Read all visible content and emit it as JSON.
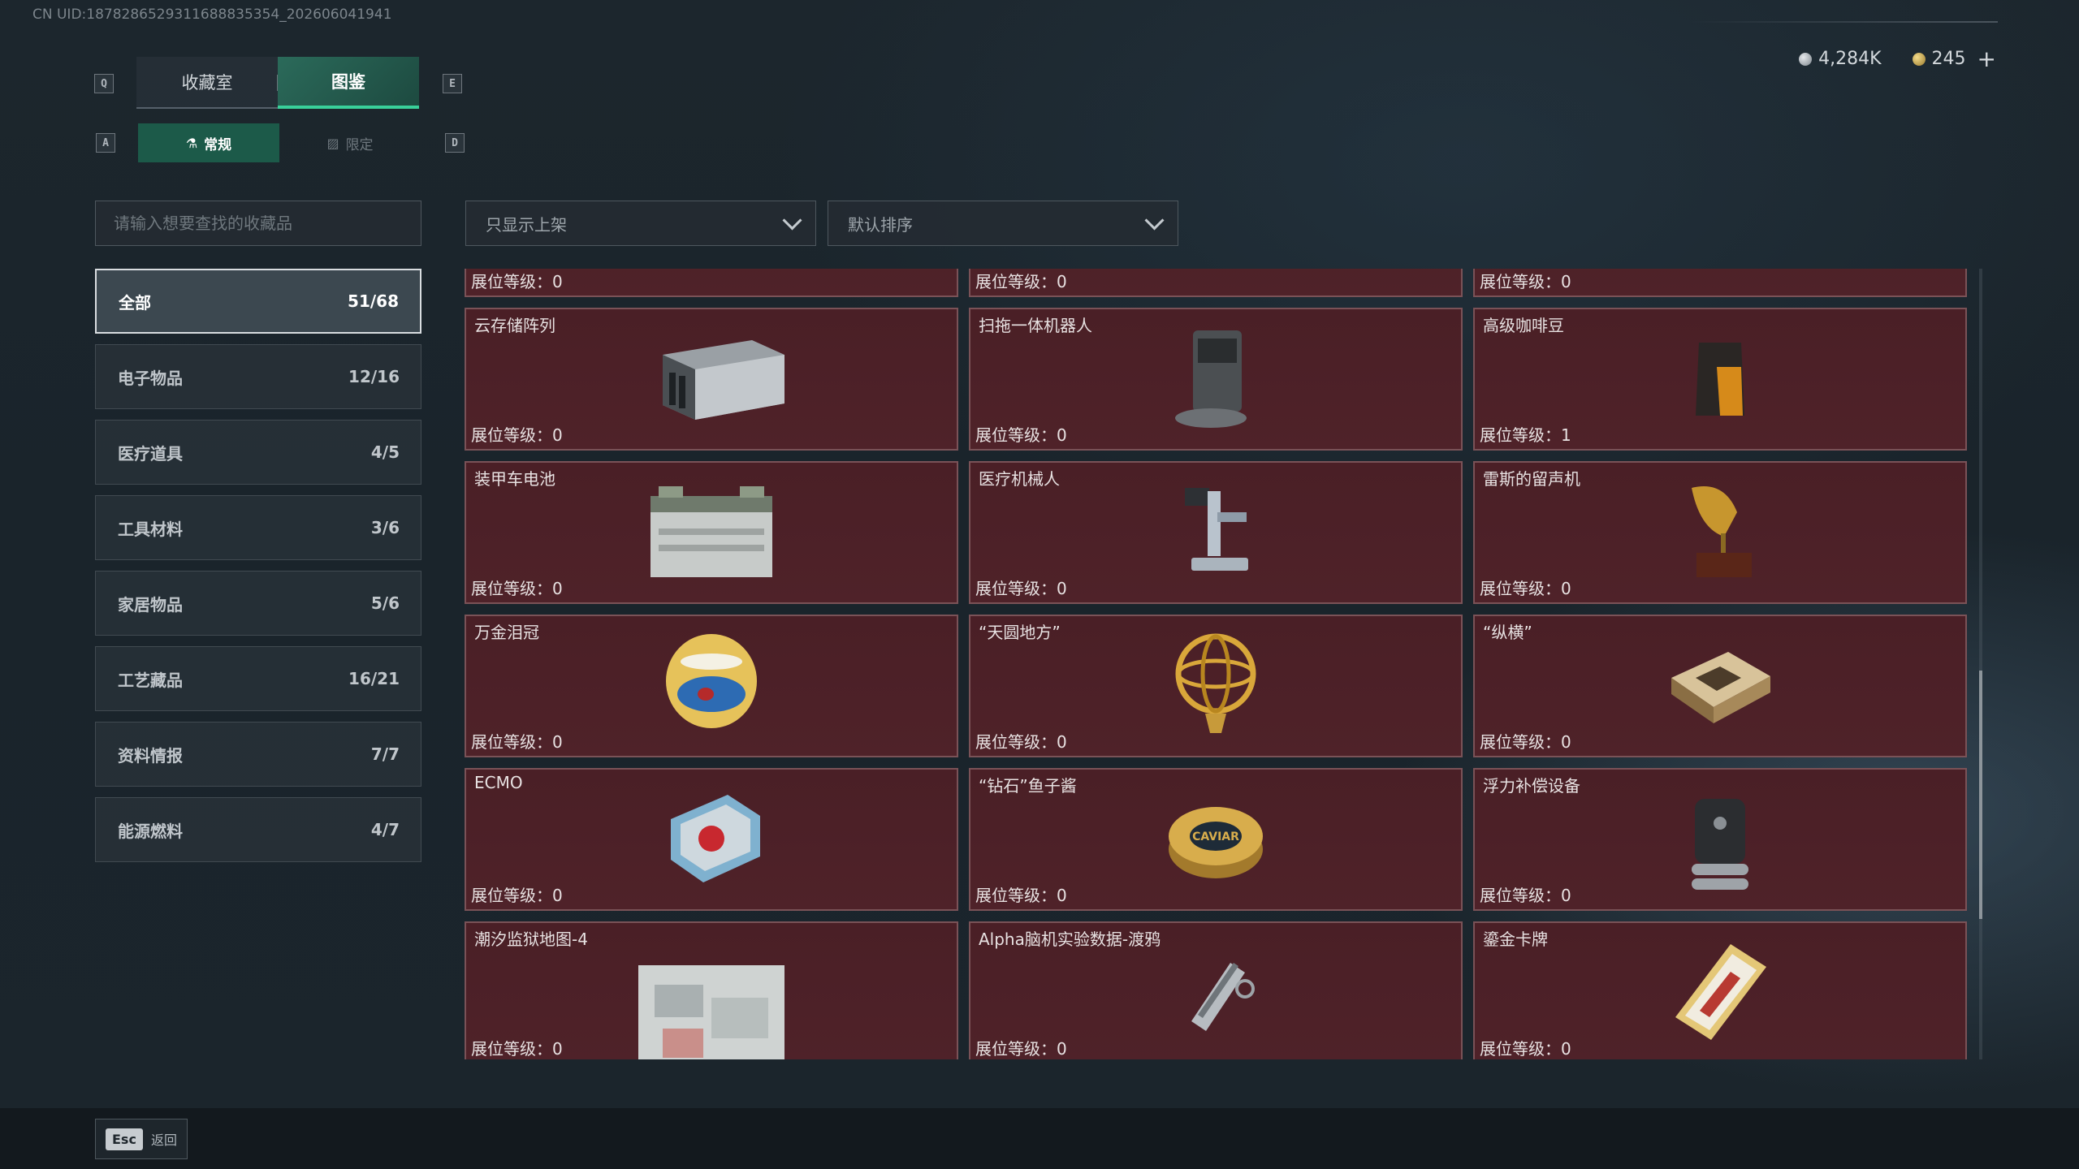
{
  "uid": "CN UID:1878286529311688835354_202606041941",
  "keys": {
    "prev_tab": "Q",
    "next_tab": "E",
    "prev_sub": "A",
    "next_sub": "D"
  },
  "main_tabs": [
    {
      "label": "收藏室"
    },
    {
      "label": "图鉴"
    }
  ],
  "sub_tabs": [
    {
      "label": "常规",
      "icon": "flask-icon"
    },
    {
      "label": "限定",
      "icon": "image-icon"
    }
  ],
  "currency": {
    "silver": "4,284K",
    "gold": "245",
    "add": "+"
  },
  "search": {
    "placeholder": "请输入想要查找的收藏品"
  },
  "filters": {
    "shelf": "只显示上架",
    "sort": "默认排序"
  },
  "categories": [
    {
      "label": "全部",
      "count": "51/68"
    },
    {
      "label": "电子物品",
      "count": "12/16"
    },
    {
      "label": "医疗道具",
      "count": "4/5"
    },
    {
      "label": "工具材料",
      "count": "3/6"
    },
    {
      "label": "家居物品",
      "count": "5/6"
    },
    {
      "label": "工艺藏品",
      "count": "16/21"
    },
    {
      "label": "资料情报",
      "count": "7/7"
    },
    {
      "label": "能源燃料",
      "count": "4/7"
    }
  ],
  "items": [
    {
      "name": "",
      "level": "展位等级：0",
      "icon": "crate-icon"
    },
    {
      "name": "",
      "level": "展位等级：0",
      "icon": "device-icon"
    },
    {
      "name": "",
      "level": "展位等级：0",
      "icon": "drone-icon"
    },
    {
      "name": "云存储阵列",
      "level": "展位等级：0",
      "icon": "server-array-icon"
    },
    {
      "name": "扫拖一体机器人",
      "level": "展位等级：0",
      "icon": "robot-vacuum-icon"
    },
    {
      "name": "高级咖啡豆",
      "level": "展位等级：1",
      "icon": "coffee-bag-icon"
    },
    {
      "name": "装甲车电池",
      "level": "展位等级：0",
      "icon": "battery-icon"
    },
    {
      "name": "医疗机械人",
      "level": "展位等级：0",
      "icon": "medical-robot-icon"
    },
    {
      "name": "雷斯的留声机",
      "level": "展位等级：0",
      "icon": "gramophone-icon"
    },
    {
      "name": "万金泪冠",
      "level": "展位等级：0",
      "icon": "jeweled-egg-icon"
    },
    {
      "name": "“天圆地方”",
      "level": "展位等级：0",
      "icon": "armillary-sphere-icon"
    },
    {
      "name": "“纵横”",
      "level": "展位等级：0",
      "icon": "chessboard-icon"
    },
    {
      "name": "ECMO",
      "level": "展位等级：0",
      "icon": "ecmo-machine-icon"
    },
    {
      "name": "“钻石”鱼子酱",
      "level": "展位等级：0",
      "icon": "caviar-tin-icon",
      "tin_text": "CAVIAR"
    },
    {
      "name": "浮力补偿设备",
      "level": "展位等级：0",
      "icon": "bcd-vest-icon"
    },
    {
      "name": "潮汐监狱地图-4",
      "level": "展位等级：0",
      "icon": "map-icon"
    },
    {
      "name": "Alpha脑机实验数据-渡鸦",
      "level": "展位等级：0",
      "icon": "data-capsule-icon"
    },
    {
      "name": "鎏金卡牌",
      "level": "展位等级：0",
      "icon": "gold-card-icon"
    }
  ],
  "footer": {
    "esc_key": "Esc",
    "esc_label": "返回"
  },
  "colors": {
    "accent": "#39d09a",
    "card_bg": "#4a1f26",
    "card_border": "#7a5257"
  }
}
